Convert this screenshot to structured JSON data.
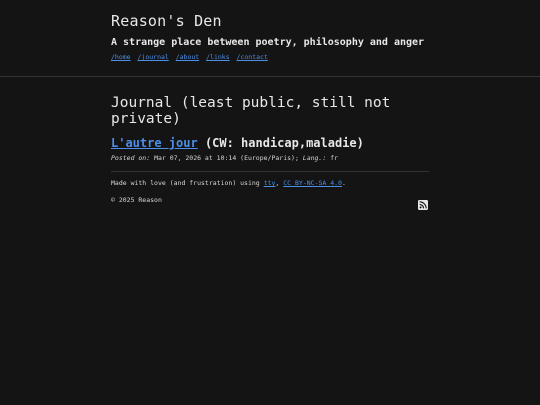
{
  "header": {
    "site_title": "Reason's Den",
    "tagline": "A strange place between poetry, philosophy and anger",
    "nav": [
      {
        "label": "/home"
      },
      {
        "label": "/journal"
      },
      {
        "label": "/about"
      },
      {
        "label": "/links"
      },
      {
        "label": "/contact"
      }
    ]
  },
  "main": {
    "page_title": "Journal (least public, still not private)",
    "entry": {
      "title": "L'autre jour",
      "content_warning": "(CW: handicap,maladie)",
      "posted_on_label": "Posted on:",
      "posted_on_value": "Mar 07, 2026 at 10:14 (Europe/Paris);",
      "lang_label": "Lang.:",
      "lang_value": "fr"
    }
  },
  "footer": {
    "made_prefix": "Made with love (and frustration) using",
    "tool_link": "tty",
    "separator": ",",
    "license_link": "CC BY-NC-SA 4.0",
    "suffix": ".",
    "copyright": "© 2025 Reason",
    "rss_icon": "rss-icon"
  },
  "colors": {
    "background": "#141414",
    "text": "#e8e8e8",
    "link": "#4d8ee6"
  }
}
